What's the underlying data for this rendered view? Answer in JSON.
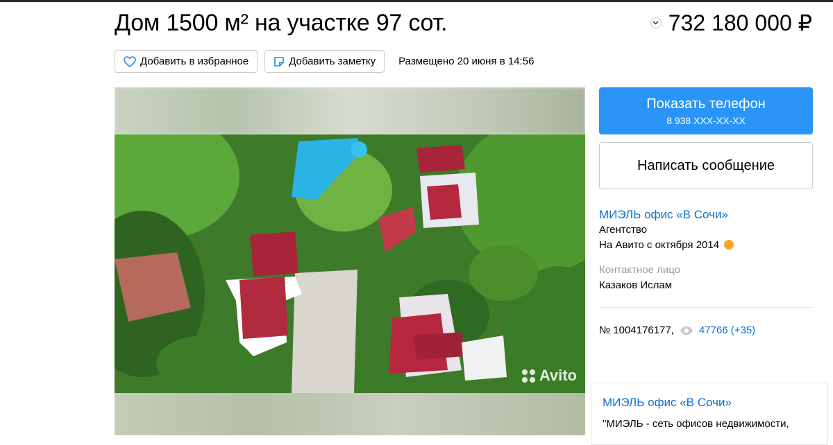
{
  "listing": {
    "title": "Дом 1500 м² на участке 97 сот.",
    "price": "732 180 000 ₽",
    "posted": "Размещено 20 июня в 14:56"
  },
  "actions": {
    "favorite_label": "Добавить в избранное",
    "note_label": "Добавить заметку"
  },
  "gallery": {
    "watermark": "Avito"
  },
  "sidebar": {
    "show_phone_label": "Показать телефон",
    "phone_masked": "8 938 XXX-XX-XX",
    "write_message_label": "Написать сообщение",
    "seller_name": "МИЭЛЬ офис «В Сочи»",
    "seller_type": "Агентство",
    "seller_since": "На Авито с октября 2014",
    "contact_label": "Контактное лицо",
    "contact_name": "Казаков Ислам",
    "ad_number": "№ 1004176177,",
    "views": "47766 (+35)"
  },
  "agency": {
    "name": "МИЭЛЬ офис «В Сочи»",
    "description": "\"МИЭЛЬ - сеть офисов недвижимости,"
  },
  "colors": {
    "accent": "#2a95f6",
    "link": "#0a6fd1",
    "muted": "#9a9a9a"
  }
}
